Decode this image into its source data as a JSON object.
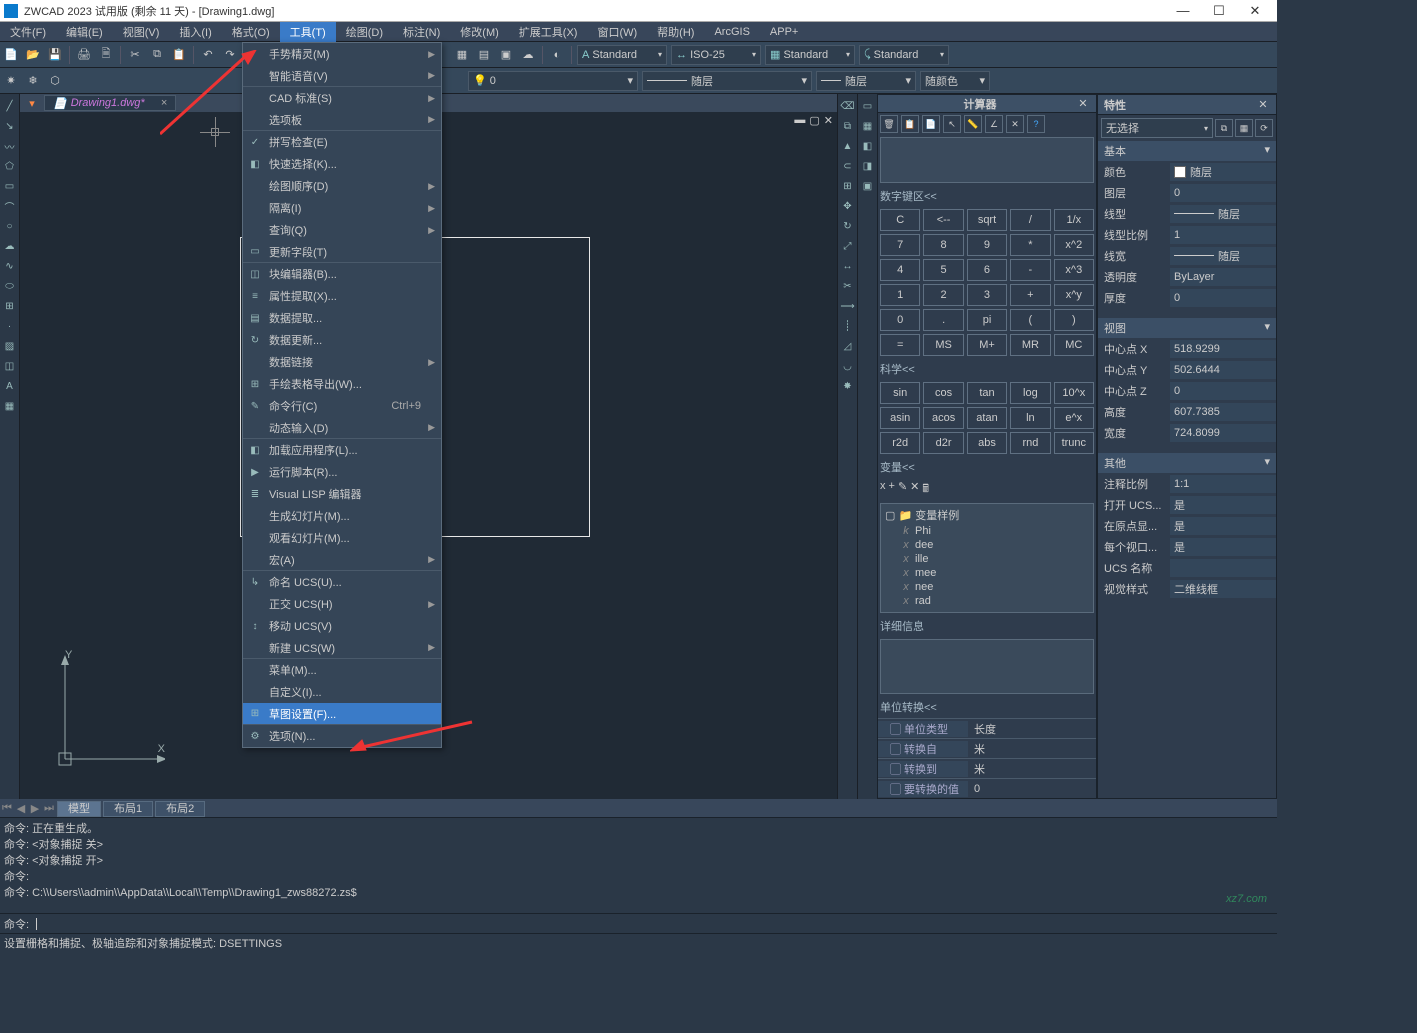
{
  "title_bar": "ZWCAD 2023 试用版 (剩余 11 天) - [Drawing1.dwg]",
  "win_buttons": {
    "min": "—",
    "max": "☐",
    "close": "✕"
  },
  "menus": [
    "文件(F)",
    "编辑(E)",
    "视图(V)",
    "插入(I)",
    "格式(O)",
    "工具(T)",
    "绘图(D)",
    "标注(N)",
    "修改(M)",
    "扩展工具(X)",
    "窗口(W)",
    "帮助(H)",
    "ArcGIS",
    "APP+"
  ],
  "active_menu_index": 5,
  "toolbar1": {
    "std1": "Standard",
    "std2": "ISO-25",
    "std3": "Standard",
    "std4": "Standard"
  },
  "toolbar2": {
    "layer": "0",
    "ltype": "随层",
    "lweight": "随层",
    "color": "随颜色"
  },
  "doc_tab": {
    "name": "Drawing1.dwg*",
    "close": "×"
  },
  "ucs": {
    "x": "X",
    "y": "Y"
  },
  "dropdown_items": [
    {
      "label": "手势精灵(M)",
      "arrow": true
    },
    {
      "label": "智能语音(V)",
      "arrow": true,
      "sep": true
    },
    {
      "label": "CAD 标准(S)",
      "arrow": true
    },
    {
      "label": "选项板",
      "arrow": true,
      "sep": true
    },
    {
      "label": "拼写检查(E)",
      "icon": "✓"
    },
    {
      "label": "快速选择(K)...",
      "icon": "◧"
    },
    {
      "label": "绘图顺序(D)",
      "arrow": true
    },
    {
      "label": "隔离(I)",
      "arrow": true
    },
    {
      "label": "查询(Q)",
      "arrow": true
    },
    {
      "label": "更新字段(T)",
      "icon": "▭",
      "sep": true
    },
    {
      "label": "块编辑器(B)...",
      "icon": "◫"
    },
    {
      "label": "属性提取(X)...",
      "icon": "≡"
    },
    {
      "label": "数据提取...",
      "icon": "▤"
    },
    {
      "label": "数据更新...",
      "icon": "↻"
    },
    {
      "label": "数据链接",
      "arrow": true
    },
    {
      "label": "手绘表格导出(W)...",
      "icon": "⊞"
    },
    {
      "label": "命令行(C)",
      "icon": "✎",
      "accel": "Ctrl+9"
    },
    {
      "label": "动态输入(D)",
      "arrow": true,
      "sep": true
    },
    {
      "label": "加载应用程序(L)...",
      "icon": "◧"
    },
    {
      "label": "运行脚本(R)...",
      "icon": "▶"
    },
    {
      "label": "Visual LISP 编辑器",
      "icon": "≣"
    },
    {
      "label": "生成幻灯片(M)..."
    },
    {
      "label": "观看幻灯片(M)..."
    },
    {
      "label": "宏(A)",
      "arrow": true,
      "sep": true
    },
    {
      "label": "命名 UCS(U)...",
      "icon": "↳"
    },
    {
      "label": "正交 UCS(H)",
      "arrow": true
    },
    {
      "label": "移动 UCS(V)",
      "icon": "↕"
    },
    {
      "label": "新建 UCS(W)",
      "arrow": true,
      "sep": true
    },
    {
      "label": "菜单(M)..."
    },
    {
      "label": "自定义(I)..."
    },
    {
      "label": "草图设置(F)...",
      "icon": "⊞",
      "hl": true,
      "sep": true
    },
    {
      "label": "选项(N)...",
      "icon": "⚙"
    }
  ],
  "calc": {
    "title": "计算器",
    "numkeys_title": "数字键区<<",
    "rows": [
      [
        "C",
        "<--",
        "sqrt",
        "/",
        "1/x"
      ],
      [
        "7",
        "8",
        "9",
        "*",
        "x^2"
      ],
      [
        "4",
        "5",
        "6",
        "-",
        "x^3"
      ],
      [
        "1",
        "2",
        "3",
        "+",
        "x^y"
      ],
      [
        "0",
        ".",
        "pi",
        "(",
        ")"
      ],
      [
        "=",
        "MS",
        "M+",
        "MR",
        "MC"
      ]
    ],
    "science_title": "科学<<",
    "science_rows": [
      [
        "sin",
        "cos",
        "tan",
        "log",
        "10^x"
      ],
      [
        "asin",
        "acos",
        "atan",
        "ln",
        "e^x"
      ],
      [
        "r2d",
        "d2r",
        "abs",
        "rnd",
        "trunc"
      ]
    ],
    "vars_title": "变量<<",
    "var_root": "变量样例",
    "vars": [
      [
        "k",
        "Phi"
      ],
      [
        "x",
        "dee"
      ],
      [
        "x",
        "ille"
      ],
      [
        "x",
        "mee"
      ],
      [
        "x",
        "nee"
      ],
      [
        "x",
        "rad"
      ]
    ],
    "detail_title": "详细信息",
    "unit_title": "单位转换<<",
    "unit_rows": [
      [
        "单位类型",
        "长度"
      ],
      [
        "转换自",
        "米"
      ],
      [
        "转换到",
        "米"
      ],
      [
        "要转换的值",
        "0"
      ]
    ]
  },
  "props": {
    "title": "特性",
    "select": "无选择",
    "groups": [
      {
        "title": "基本",
        "rows": [
          [
            "颜色",
            "随层",
            "swatch"
          ],
          [
            "图层",
            "0"
          ],
          [
            "线型",
            "随层",
            "line"
          ],
          [
            "线型比例",
            "1"
          ],
          [
            "线宽",
            "随层",
            "line"
          ],
          [
            "透明度",
            "ByLayer"
          ],
          [
            "厚度",
            "0"
          ]
        ]
      },
      {
        "title": "视图",
        "rows": [
          [
            "中心点 X",
            "518.9299"
          ],
          [
            "中心点 Y",
            "502.6444"
          ],
          [
            "中心点 Z",
            "0"
          ],
          [
            "高度",
            "607.7385"
          ],
          [
            "宽度",
            "724.8099"
          ]
        ]
      },
      {
        "title": "其他",
        "rows": [
          [
            "注释比例",
            "1:1"
          ],
          [
            "打开 UCS...",
            "是"
          ],
          [
            "在原点显...",
            "是"
          ],
          [
            "每个视口...",
            "是"
          ],
          [
            "UCS 名称",
            ""
          ],
          [
            "视觉样式",
            "二维线框"
          ]
        ]
      }
    ]
  },
  "bottom_tabs": [
    "模型",
    "布局1",
    "布局2"
  ],
  "cmd_lines": [
    "命令: 正在重生成。",
    "命令: <对象捕捉 关>",
    "命令: <对象捕捉 开>",
    "命令:",
    "命令: C:\\\\Users\\\\admin\\\\AppData\\\\Local\\\\Temp\\\\Drawing1_zws88272.zs$"
  ],
  "cmd_prompt": "命令:",
  "statusbar": "设置栅格和捕捉、极轴追踪和对象捕捉模式: DSETTINGS",
  "watermark": "xz7.com"
}
